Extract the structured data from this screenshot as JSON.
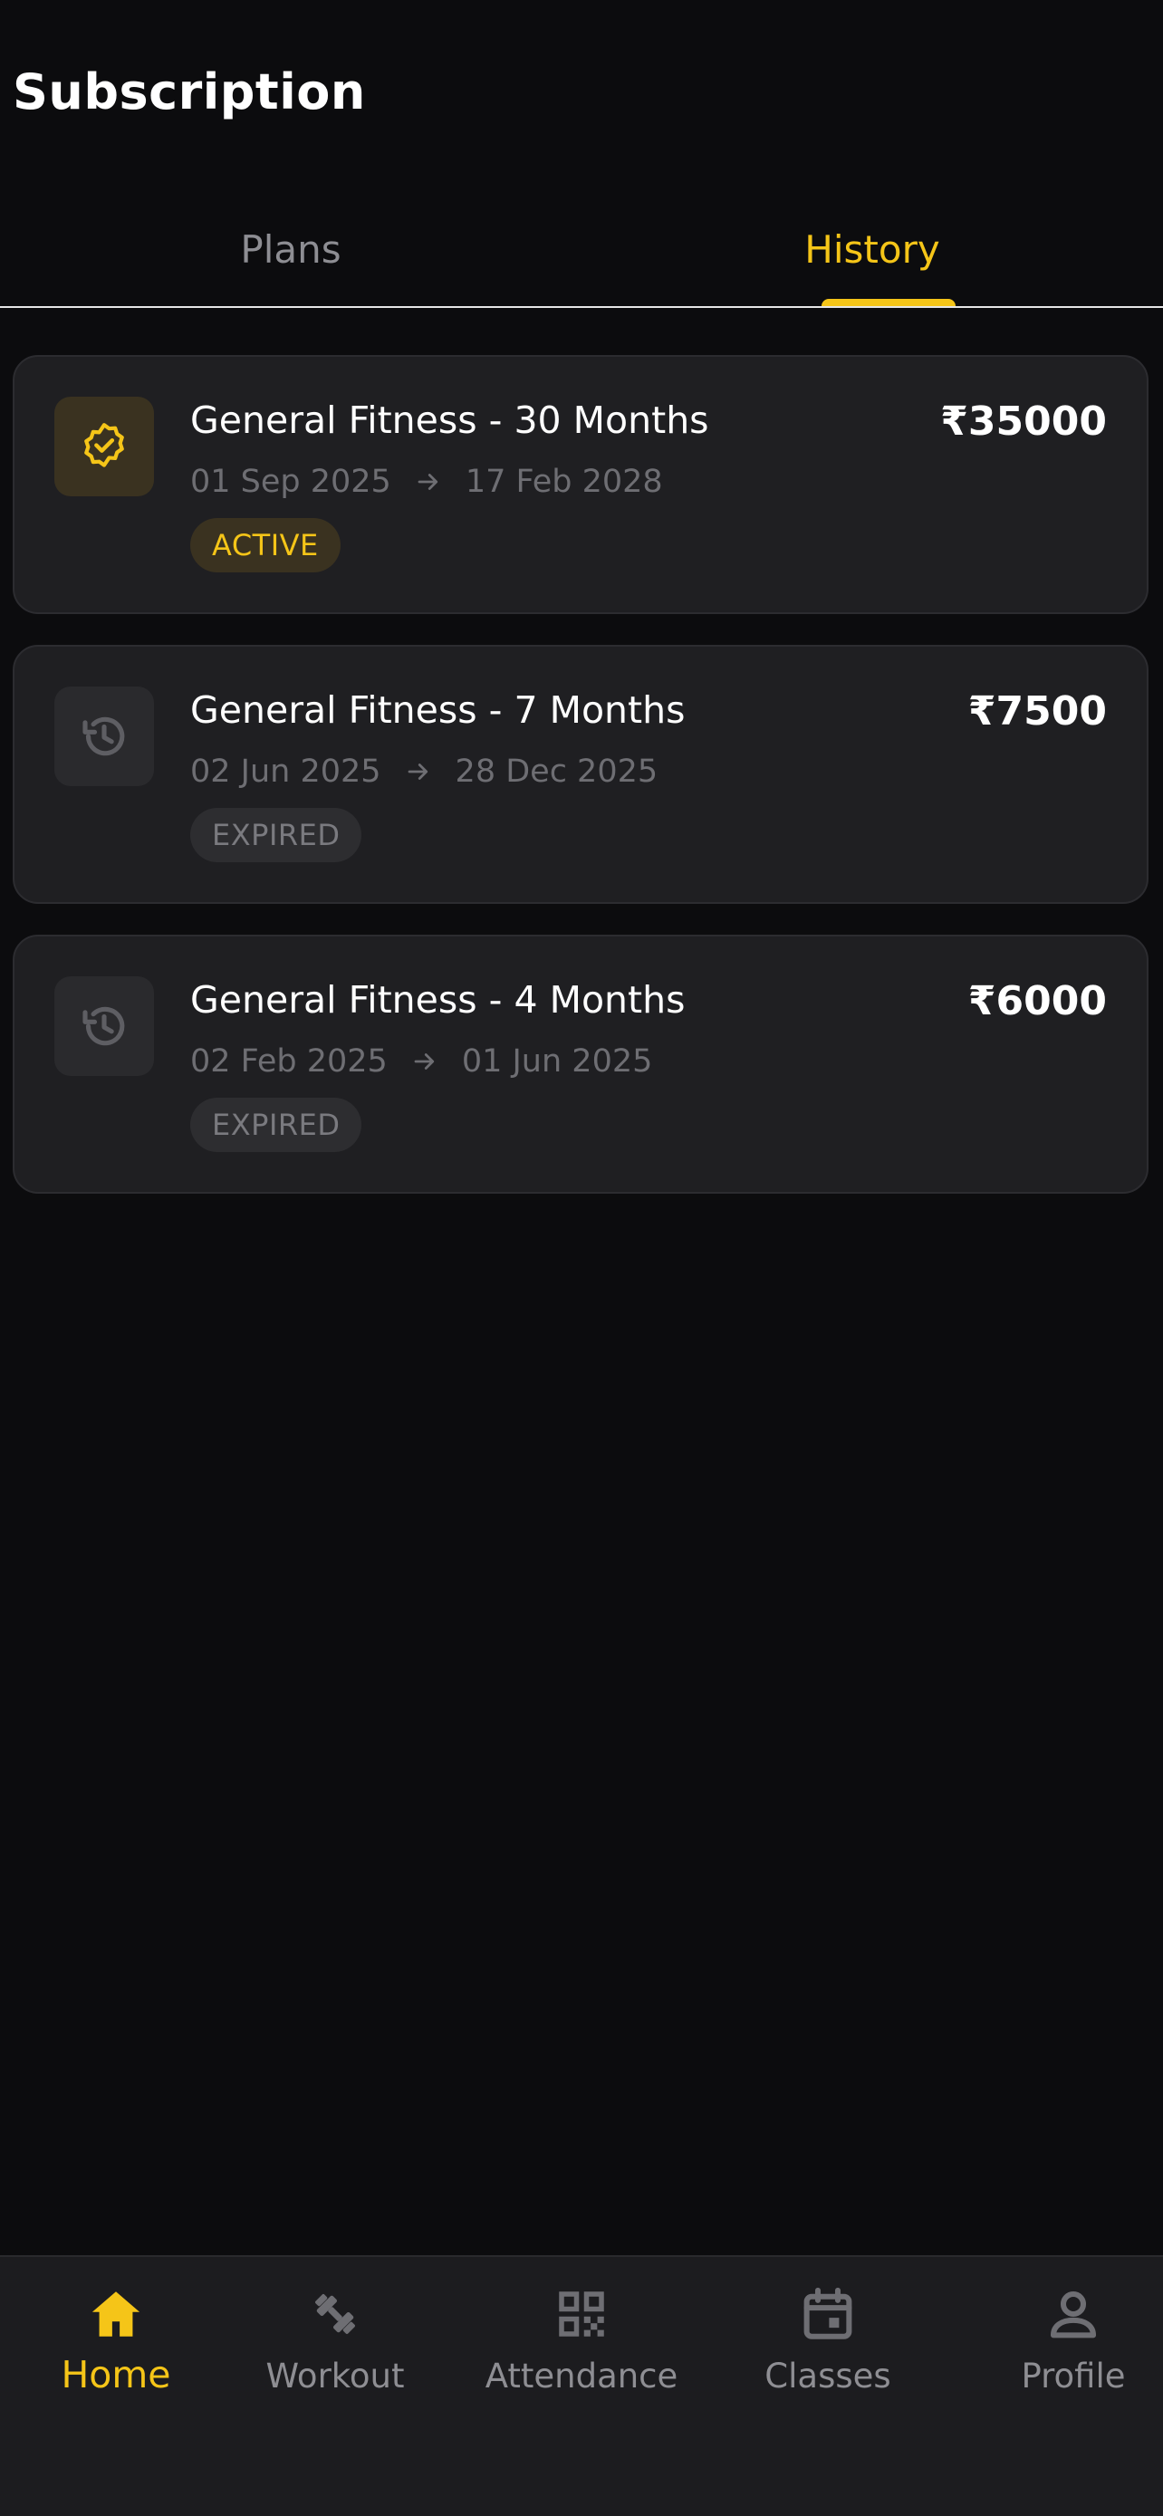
{
  "header": {
    "title": "Subscription"
  },
  "tabs": [
    {
      "label": "Plans",
      "selected": false
    },
    {
      "label": "History",
      "selected": true
    }
  ],
  "subscriptions": [
    {
      "name": "General Fitness - 30 Months",
      "price": "₹35000",
      "start": "01 Sep 2025",
      "end": "17 Feb 2028",
      "status": "ACTIVE",
      "icon": "verified-badge-icon"
    },
    {
      "name": "General Fitness - 7 Months",
      "price": "₹7500",
      "start": "02 Jun 2025",
      "end": "28 Dec 2025",
      "status": "EXPIRED",
      "icon": "history-icon"
    },
    {
      "name": "General Fitness - 4 Months",
      "price": "₹6000",
      "start": "02 Feb 2025",
      "end": "01 Jun 2025",
      "status": "EXPIRED",
      "icon": "history-icon"
    }
  ],
  "bottom_nav": [
    {
      "label": "Home",
      "icon": "home-icon",
      "selected": true
    },
    {
      "label": "Workout",
      "icon": "dumbbell-icon",
      "selected": false
    },
    {
      "label": "Attendance",
      "icon": "qr-code-icon",
      "selected": false
    },
    {
      "label": "Classes",
      "icon": "calendar-icon",
      "selected": false
    },
    {
      "label": "Profile",
      "icon": "person-icon",
      "selected": false
    }
  ],
  "colors": {
    "background": "#0c0c0e",
    "card": "#1f1f22",
    "accent": "#f5c518",
    "muted_text": "#6e6e73",
    "nav_background": "#1c1c1f"
  }
}
